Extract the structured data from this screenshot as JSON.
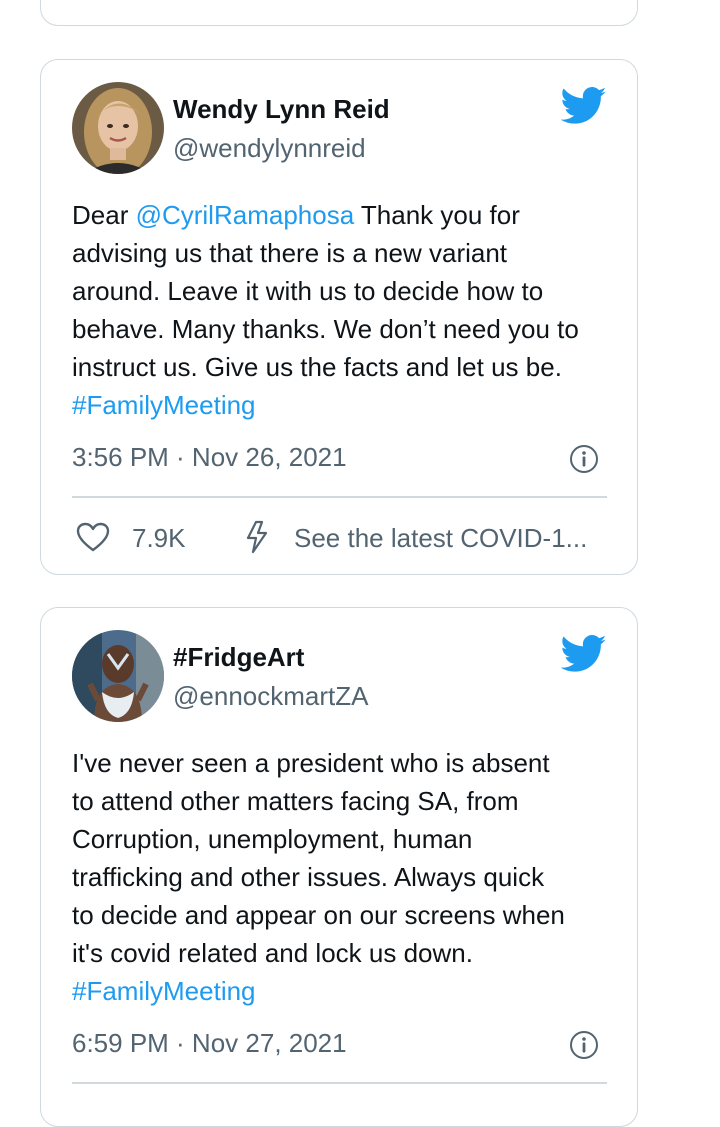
{
  "tweets": [
    {
      "name": "Wendy Lynn Reid",
      "handle": "@wendylynnreid",
      "text_prefix": "Dear ",
      "mention": "@CyrilRamaphosa",
      "text_line1_rest": " Thank you for",
      "text_line2": "advising us that there is a new variant",
      "text_line3": "around. Leave it with us to decide how to",
      "text_line4": "behave. Many thanks. We don’t need you to",
      "text_line5": "instruct us. Give us the facts and let us be.",
      "hashtag": "#FamilyMeeting",
      "timestamp": "3:56 PM · Nov 26, 2021",
      "like_count": "7.9K",
      "covid_link": "See the latest COVID-1..."
    },
    {
      "name": "#FridgeArt",
      "handle": "@ennockmartZA",
      "text_line1": "I've never seen a president who is absent",
      "text_line2": "to attend other matters facing SA, from",
      "text_line3": "Corruption, unemployment, human",
      "text_line4": "trafficking and other issues. Always quick",
      "text_line5": "to decide and appear on our screens when",
      "text_line6": "it's covid related and lock us down.",
      "hashtag": "#FamilyMeeting",
      "timestamp": "6:59 PM · Nov 27, 2021"
    }
  ],
  "icons": {
    "brand": "twitter-bird-icon",
    "info": "info-icon",
    "like": "heart-icon",
    "covid": "lightning-bolt-icon"
  },
  "colors": {
    "link": "#1d9bf0",
    "muted": "#536471",
    "border": "#cfd9de",
    "brand": "#1d9bf0"
  }
}
